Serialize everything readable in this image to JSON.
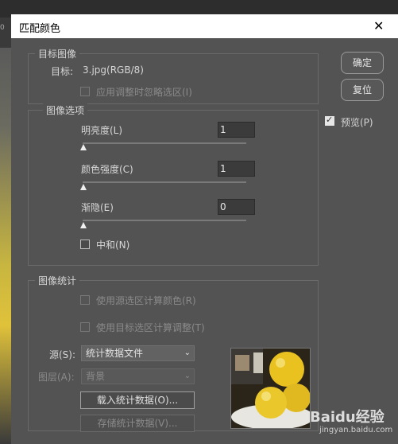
{
  "background": {
    "corner_text": "0"
  },
  "dialog": {
    "title": "匹配颜色"
  },
  "target_group": {
    "legend": "目标图像",
    "target_label": "目标:",
    "target_value": "3.jpg(RGB/8)",
    "ignore_selection_label": "应用调整时忽略选区(I)"
  },
  "options_group": {
    "legend": "图像选项",
    "luminance_label": "明亮度(L)",
    "luminance_value": "1",
    "color_intensity_label": "颜色强度(C)",
    "color_intensity_value": "1",
    "fade_label": "渐隐(E)",
    "fade_value": "0",
    "neutralize_label": "中和(N)"
  },
  "stats_group": {
    "legend": "图像统计",
    "use_source_selection_label": "使用源选区计算颜色(R)",
    "use_target_selection_label": "使用目标选区计算调整(T)",
    "source_label": "源(S):",
    "source_value": "统计数据文件",
    "layer_label": "图层(A):",
    "layer_value": "背景",
    "load_stats_button": "载入统计数据(O)...",
    "save_stats_button": "存储统计数据(V)..."
  },
  "buttons": {
    "ok": "确定",
    "reset": "复位"
  },
  "preview": {
    "label": "预览(P)",
    "checked": true
  },
  "watermark": {
    "brand": "Baidu经验",
    "url": "jingyan.baidu.com"
  }
}
